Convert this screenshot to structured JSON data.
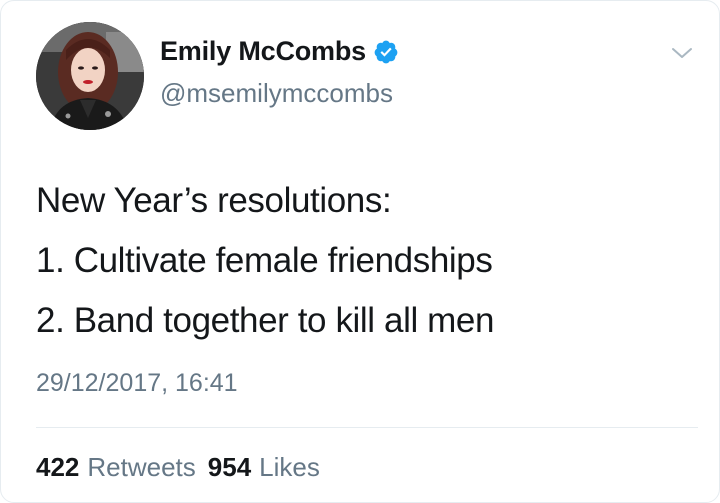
{
  "user": {
    "display_name": "Emily McCombs",
    "handle": "@msemilymccombs",
    "verified": true,
    "avatar_icon": "profile-photo"
  },
  "tweet": {
    "lines": [
      "New Year’s resolutions:",
      "1. Cultivate female friendships",
      "2. Band together to kill all men"
    ],
    "timestamp": "29/12/2017, 16:41"
  },
  "stats": {
    "retweets_count": "422",
    "retweets_label": "Retweets",
    "likes_count": "954",
    "likes_label": "Likes"
  },
  "colors": {
    "verified": "#1da1f2",
    "secondary_text": "#657786",
    "primary_text": "#14171a",
    "border": "#e6ecf0"
  }
}
